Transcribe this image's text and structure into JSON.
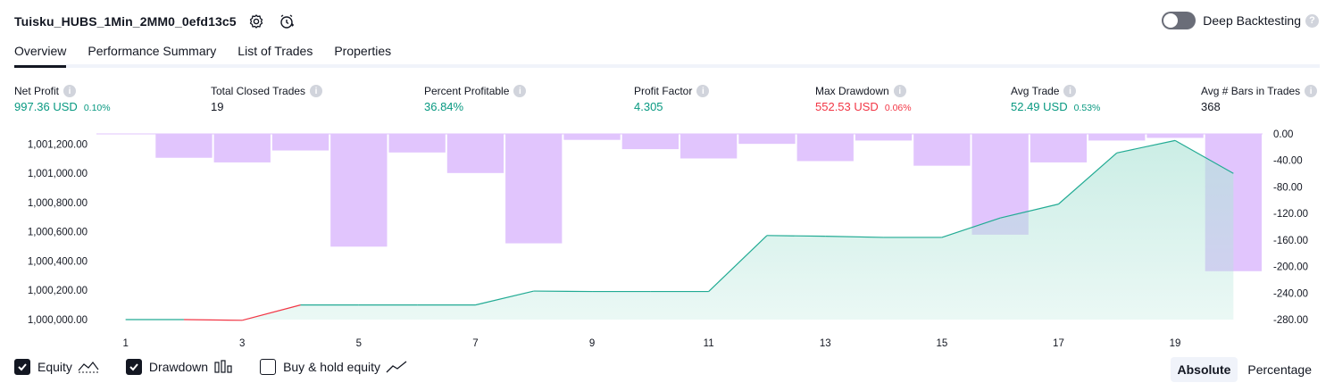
{
  "header": {
    "strategy_name": "Tuisku_HUBS_1Min_2MM0_0efd13c5",
    "deep_backtesting_label": "Deep Backtesting"
  },
  "tabs": [
    "Overview",
    "Performance Summary",
    "List of Trades",
    "Properties"
  ],
  "metrics": [
    {
      "label": "Net Profit",
      "value": "997.36 USD",
      "pct": "0.10%",
      "color": "green"
    },
    {
      "label": "Total Closed Trades",
      "value": "19",
      "pct": "",
      "color": "neutral"
    },
    {
      "label": "Percent Profitable",
      "value": "36.84%",
      "pct": "",
      "color": "green"
    },
    {
      "label": "Profit Factor",
      "value": "4.305",
      "pct": "",
      "color": "green"
    },
    {
      "label": "Max Drawdown",
      "value": "552.53 USD",
      "pct": "0.06%",
      "color": "red"
    },
    {
      "label": "Avg Trade",
      "value": "52.49 USD",
      "pct": "0.53%",
      "color": "green"
    },
    {
      "label": "Avg # Bars in Trades",
      "value": "368",
      "pct": "",
      "color": "neutral"
    }
  ],
  "legend": {
    "equity_label": "Equity",
    "drawdown_label": "Drawdown",
    "buyhold_label": "Buy & hold equity",
    "equity_checked": true,
    "drawdown_checked": true,
    "buyhold_checked": false
  },
  "mode": {
    "absolute_label": "Absolute",
    "percentage_label": "Percentage",
    "selected": "Absolute"
  },
  "colors": {
    "equity_line": "#22ab94",
    "equity_loss_line": "#f23645",
    "equity_fill": "#b2e5d9",
    "drawdown_bar": "#e1c5fd",
    "green": "#089981",
    "red": "#f23645"
  },
  "chart_data": {
    "type": "area",
    "x": [
      1,
      2,
      3,
      4,
      5,
      6,
      7,
      8,
      9,
      10,
      11,
      12,
      13,
      14,
      15,
      16,
      17,
      18,
      19,
      20
    ],
    "x_tick_labels": [
      "1",
      "3",
      "5",
      "7",
      "9",
      "11",
      "13",
      "15",
      "17",
      "19"
    ],
    "series": [
      {
        "name": "Equity",
        "axis": "left",
        "type": "area",
        "values": [
          1000000,
          1000000,
          999995,
          1000100,
          1000100,
          1000100,
          1000100,
          1000195,
          1000192,
          1000192,
          1000192,
          1000575,
          1000570,
          1000562,
          1000562,
          1000695,
          1000790,
          1001140,
          1001225,
          1001000
        ]
      },
      {
        "name": "Drawdown",
        "axis": "right",
        "type": "bar",
        "values": [
          0,
          -36,
          -43,
          -25,
          -170,
          -28,
          -59,
          -165,
          -9,
          -23,
          -37,
          -15,
          -41,
          -10,
          -48,
          -152,
          -43,
          -10,
          -6,
          -207
        ]
      }
    ],
    "left_axis": {
      "ticks": [
        "1,000,000.00",
        "1,000,200.00",
        "1,000,400.00",
        "1,000,600.00",
        "1,000,800.00",
        "1,001,000.00",
        "1,001,200.00"
      ],
      "range": [
        1000000,
        1001270
      ]
    },
    "right_axis": {
      "ticks": [
        "0.00",
        "-40.00",
        "-80.00",
        "-120.00",
        "-160.00",
        "-200.00",
        "-240.00",
        "-280.00"
      ],
      "range": [
        -280,
        0
      ]
    }
  }
}
